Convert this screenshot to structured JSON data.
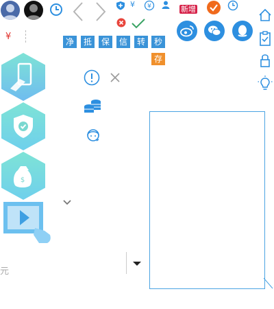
{
  "toolbar": {
    "currency_symbol": "¥",
    "new_badge": "新增"
  },
  "tags": [
    "净",
    "抵",
    "保",
    "信",
    "转",
    "秒"
  ],
  "deposit_tag": "存",
  "left": {
    "currency_symbol": "¥"
  },
  "amount": {
    "unit": "元"
  },
  "colors": {
    "accent_blue": "#2d8fe0",
    "tag_blue": "#3a93d8",
    "deposit_orange": "#f0902c",
    "new_red": "#d6234a",
    "hex_teal": "#6fd8d0"
  }
}
